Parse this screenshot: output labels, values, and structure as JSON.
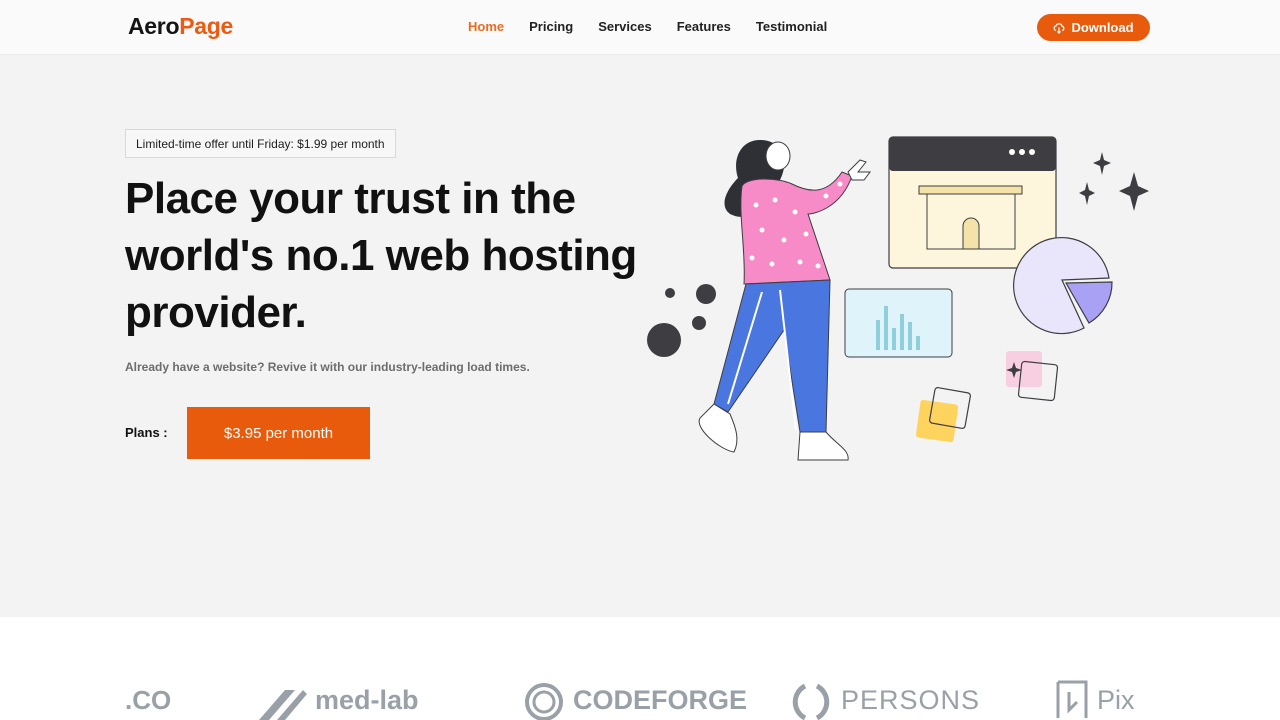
{
  "header": {
    "logo_part1": "Aero",
    "logo_part2": "Page",
    "nav": [
      "Home",
      "Pricing",
      "Services",
      "Features",
      "Testimonial"
    ],
    "download_label": "Download",
    "accent": "#ee5a12"
  },
  "hero": {
    "badge": "Limited-time offer until Friday: $1.99 per month",
    "title": "Place your trust in the world's no.1 web hosting provider.",
    "subtitle": "Already have a website? Revive it with our industry-leading load times.",
    "plans_label": "Plans :",
    "plan_button": "$3.95 per month"
  },
  "partners": [
    ".CO",
    "med-lab",
    "CODEFORGE",
    "PERSONS",
    "Pix"
  ]
}
